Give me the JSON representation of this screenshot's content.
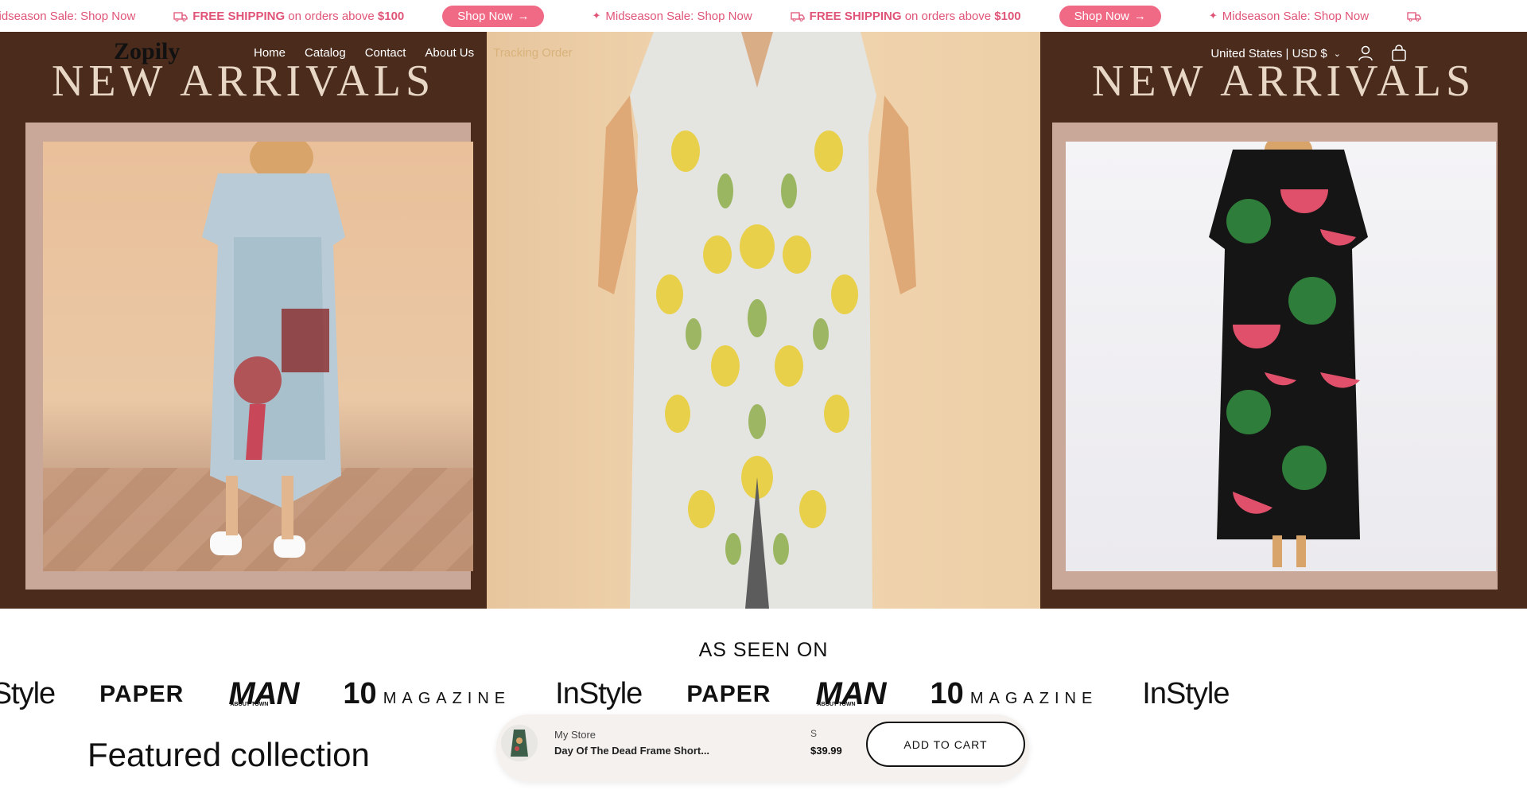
{
  "announcement": {
    "sale_text": "Midseason Sale: Shop Now",
    "shipping_bold": "FREE SHIPPING",
    "shipping_mid": " on orders above ",
    "shipping_amount": "$100",
    "pill_label": "Shop Now",
    "accent_color": "#e05577",
    "pill_color": "#f06a86"
  },
  "header": {
    "logo": "Zopily",
    "nav": [
      "Home",
      "Catalog",
      "Contact",
      "About Us",
      "Tracking Order"
    ],
    "currency": "United States | USD $"
  },
  "hero": {
    "left_heading": "NEW ARRIVALS",
    "right_heading": "NEW ARRIVALS"
  },
  "press": {
    "title": "AS SEEN ON",
    "logos": [
      "InStyle",
      "PAPER",
      "MAN",
      "10 MAGAZINE",
      "InStyle",
      "PAPER",
      "MAN",
      "10 MAGAZINE",
      "InStyle"
    ],
    "man_sub": "ABOUT TOWN",
    "ten_num": "10",
    "ten_word": "MAGAZINE"
  },
  "featured": {
    "title": "Featured collection"
  },
  "sticky_cart": {
    "store": "My Store",
    "product": "Day Of The Dead Frame Short...",
    "size": "S",
    "price": "$39.99",
    "button": "ADD TO CART"
  }
}
